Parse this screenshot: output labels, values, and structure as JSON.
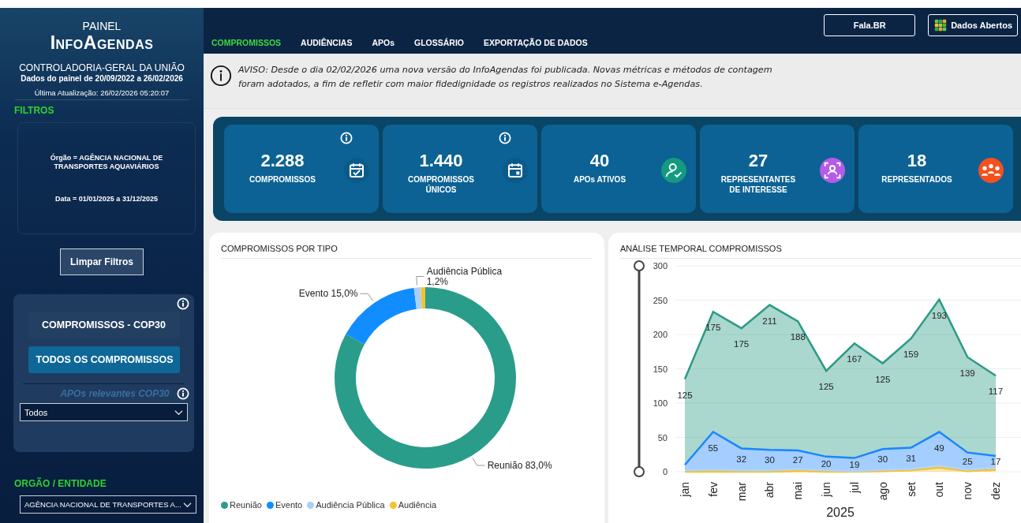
{
  "sidebar": {
    "panel_label": "PAINEL",
    "brand": "InfoAgendas",
    "organization": "CONTROLADORIA-GERAL DA UNIÃO",
    "data_range": "Dados do painel de 20/09/2022 a 26/02/2026",
    "last_update": "Última Atualização: 26/02/2026 05:20:07",
    "filters_heading": "FILTROS",
    "active_filters": [
      "Órgão = AGÊNCIA NACIONAL DE TRANSPORTES AQUAVIÁRIOS",
      "Data = 01/01/2025 a 31/12/2025"
    ],
    "clear_button": "Limpar Filtros",
    "scope_toggle": [
      {
        "label": "COMPROMISSOS - COP30",
        "selected": false
      },
      {
        "label": "TODOS OS COMPROMISSOS",
        "selected": true
      }
    ],
    "apo_filter": {
      "label": "APOs relevantes COP30",
      "value": "Todos"
    },
    "org_heading": "ORGÃO / ENTIDADE",
    "org_select": {
      "value": "AGÊNCIA NACIONAL DE TRANSPORTES A..."
    }
  },
  "top_links": [
    {
      "label": "Fala.BR",
      "kind": "plain"
    },
    {
      "label": "Dados Abertos",
      "kind": "cube"
    }
  ],
  "tabs": [
    {
      "label": "COMPROMISSOS",
      "selected": true
    },
    {
      "label": "AUDIÊNCIAS",
      "selected": false
    },
    {
      "label": "APOs",
      "selected": false
    },
    {
      "label": "GLOSSÁRIO",
      "selected": false
    },
    {
      "label": "EXPORTAÇÃO DE DADOS",
      "selected": false
    }
  ],
  "notice": "AVISO: Desde o dia 02/02/2026 uma nova versão do InfoAgendas foi publicada. Novas métricas e métodos de contagem foram adotados, a fim de refletir com maior fidedignidade os registros realizados no Sistema e-Agendas.",
  "kpis": [
    {
      "value": "2.288",
      "label": "COMPROMISSOS",
      "kind": "calendar-check",
      "color": "#0a5b8a",
      "info": true
    },
    {
      "value": "1.440",
      "label": "COMPROMISSOS ÚNICOS",
      "kind": "calendar",
      "color": "#0a5b8a",
      "info": true
    },
    {
      "value": "40",
      "label": "APOs ATIVOS",
      "kind": "person-check",
      "color": "#139a7f",
      "info": false
    },
    {
      "value": "27",
      "label": "REPRESENTANTES DE INTERESSE",
      "kind": "person-scan",
      "color": "#b45be8",
      "info": false
    },
    {
      "value": "18",
      "label": "REPRESENTADOS",
      "kind": "group",
      "color": "#f4511e",
      "info": false
    }
  ],
  "type_chart": {
    "title": "COMPROMISSOS POR TIPO",
    "chart_data": {
      "type": "donut",
      "categories": [
        "Reunião",
        "Evento",
        "Audiência Pública",
        "Audiência"
      ],
      "values": [
        83.0,
        15.0,
        1.2,
        0.8
      ],
      "colors": [
        "#2a9d8a",
        "#118dff",
        "#a8d0f8",
        "#f5c231"
      ],
      "value_labels": [
        "Reunião 83,0%",
        "Evento 15,0%",
        "Audiência Pública 1,2%",
        null
      ]
    }
  },
  "time_chart": {
    "title": "ANÁLISE TEMPORAL COMPROMISSOS",
    "chart_data": {
      "type": "area",
      "stacked": true,
      "xlabel": "2025",
      "categories": [
        "jan",
        "fev",
        "mar",
        "abr",
        "mai",
        "jun",
        "jul",
        "ago",
        "set",
        "out",
        "nov",
        "dez"
      ],
      "ylim": [
        0,
        300
      ],
      "yticks": [
        0,
        50,
        100,
        150,
        200,
        250,
        300
      ],
      "grid": true,
      "series": [
        {
          "color": "#f5c231",
          "values": [
            0,
            0,
            0,
            0,
            1,
            0,
            0,
            1,
            2,
            6,
            1,
            3
          ]
        },
        {
          "color": "#b3d4f5",
          "values": [
            2,
            3,
            2,
            2,
            3,
            2,
            1,
            2,
            2,
            3,
            2,
            3
          ]
        },
        {
          "color": "#1a85ff",
          "values": [
            8,
            55,
            32,
            30,
            27,
            20,
            19,
            30,
            31,
            49,
            25,
            17
          ],
          "value_labels": [
            null,
            "55",
            "32",
            "30",
            "27",
            "20",
            "19",
            "30",
            "31",
            "49",
            "25",
            "17"
          ]
        },
        {
          "color": "#2b9a85",
          "values": [
            125,
            175,
            175,
            211,
            188,
            125,
            167,
            125,
            159,
            193,
            139,
            117
          ],
          "value_labels": [
            "125",
            "175",
            "175",
            "211",
            "188",
            "125",
            "167",
            "125",
            "159",
            "193",
            "139",
            "117"
          ]
        }
      ]
    }
  }
}
